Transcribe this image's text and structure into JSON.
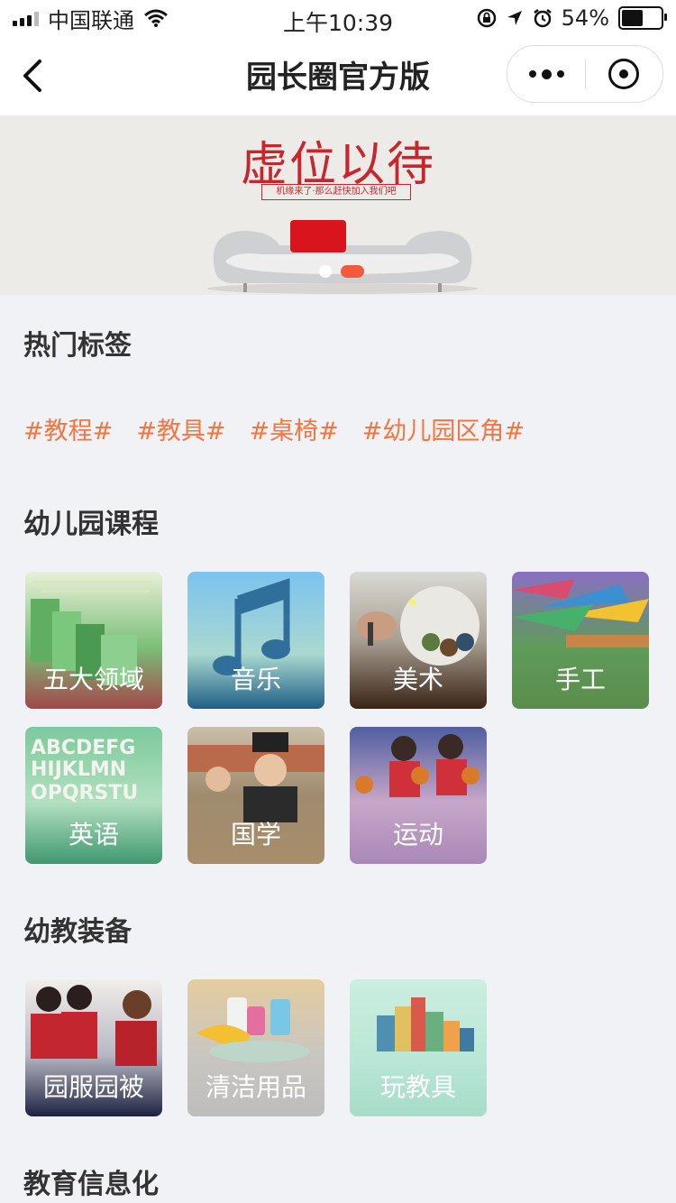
{
  "status_bar": {
    "carrier": "中国联通",
    "time": "上午10:39",
    "battery_percent": "54%",
    "battery_level": 0.54
  },
  "nav": {
    "title": "园长圈官方版"
  },
  "banner": {
    "title": "虚位以待",
    "subtitle": "机缘来了·那么赶快加入我们吧",
    "slide_count": 2,
    "active_slide": 2
  },
  "hot_tags": {
    "title": "热门标签",
    "items": [
      "#教程#",
      "#教具#",
      "#桌椅#",
      "#幼儿园区角#"
    ]
  },
  "courses": {
    "title": "幼儿园课程",
    "items": [
      {
        "label": "五大领域"
      },
      {
        "label": "音乐"
      },
      {
        "label": "美术"
      },
      {
        "label": "手工"
      },
      {
        "label": "英语"
      },
      {
        "label": "国学"
      },
      {
        "label": "运动"
      }
    ]
  },
  "equipment": {
    "title": "幼教装备",
    "items": [
      {
        "label": "园服园被"
      },
      {
        "label": "清洁用品"
      },
      {
        "label": "玩教具"
      }
    ]
  },
  "info": {
    "title": "教育信息化"
  },
  "colors": {
    "tag_accent": "#f5753f",
    "banner_red": "#c8252d",
    "page_bg": "#f1f2f5"
  }
}
